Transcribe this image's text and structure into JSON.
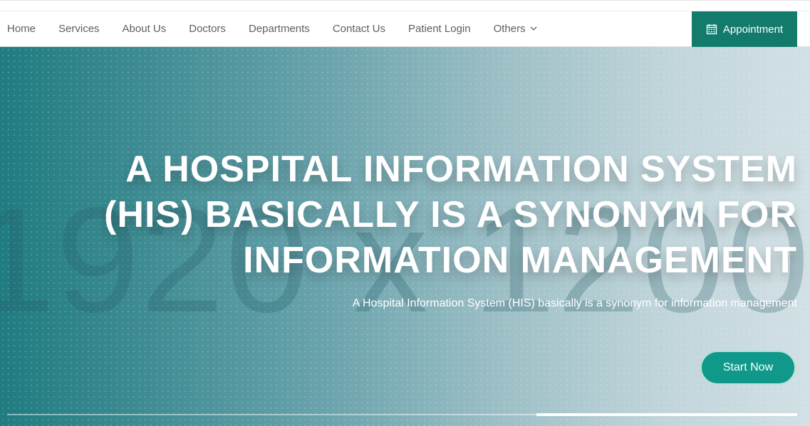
{
  "nav": {
    "items": [
      {
        "label": "Home"
      },
      {
        "label": "Services"
      },
      {
        "label": "About Us"
      },
      {
        "label": "Doctors"
      },
      {
        "label": "Departments"
      },
      {
        "label": "Contact Us"
      },
      {
        "label": "Patient Login"
      },
      {
        "label": "Others",
        "has_dropdown": true
      }
    ],
    "appointment_label": "Appointment",
    "appointment_icon": "calendar-icon"
  },
  "hero": {
    "placeholder_text": "1920 x 1200",
    "title_lines": [
      "A HOSPITAL INFORMATION SYSTEM",
      "(HIS) BASICALLY IS A SYNONYM FOR",
      "INFORMATION MANAGEMENT"
    ],
    "subtitle": "A Hospital Information System (HIS) basically is a synonym for information management",
    "cta_label": "Start Now",
    "slider_progress": 0.33
  },
  "colors": {
    "brand": "#127b6c",
    "cta": "#10998a",
    "nav_text": "#5f5f5f"
  }
}
